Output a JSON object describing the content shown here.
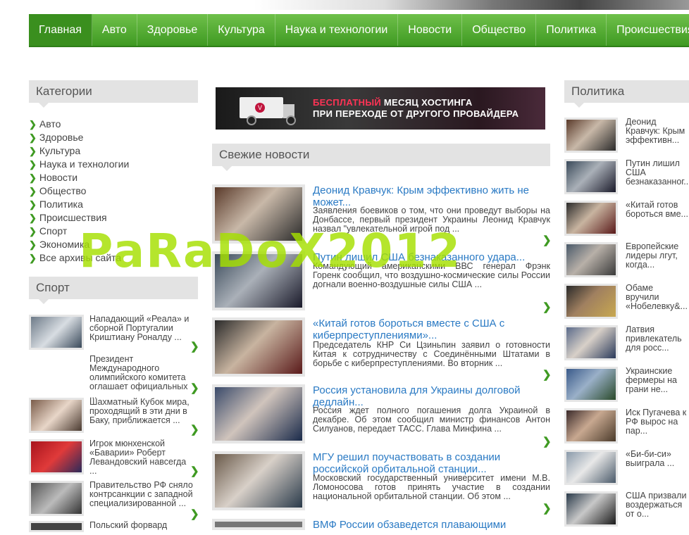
{
  "nav": [
    "Главная",
    "Авто",
    "Здоровье",
    "Культура",
    "Наука и технологии",
    "Новости",
    "Общество",
    "Политика",
    "Происшествия"
  ],
  "categories": {
    "title": "Категории",
    "items": [
      "Авто",
      "Здоровье",
      "Культура",
      "Наука и технологии",
      "Новости",
      "Общество",
      "Политика",
      "Происшествия",
      "Спорт",
      "Экономика",
      "Все архивы сайта"
    ]
  },
  "banner": {
    "line1_red": "БЕСПЛАТНЫЙ",
    "line1": " МЕСЯЦ ХОСТИНГА",
    "line2": "ПРИ ПЕРЕХОДЕ ОТ ДРУГОГО ПРОВАЙДЕРА"
  },
  "fresh": {
    "title": "Свежие новости",
    "items": [
      {
        "title": "Деонид Кравчук: Крым эффективно жить не может...",
        "text": "Заявления боевиков о том, что они проведут выборы на Донбассе, первый президент Украины Леонид Кравчук назвал \"увлекательной игрой под ..."
      },
      {
        "title": "Путин лишил США безнаказанного удара...",
        "text": "Командующий американскими ВВС генерал Фрэнк Горенк сообщил, что воздушно-космические силы России догнали военно-воздушные силы США ..."
      },
      {
        "title": "«Китай готов бороться вместе с США с киберпреступлениями»...",
        "text": "Председатель КНР Си Цзиньпин заявил о готовности Китая к сотрудничеству с Соединёнными Штатами в борьбе с киберпреступлениями. Во вторник ..."
      },
      {
        "title": "Россия установила для Украины долговой дедлайн...",
        "text": "Россия ждет полного погашения долга Украиной в декабре. Об этом сообщил министр финансов Антон Силуанов, передает ТАСС. Глава Минфина ..."
      },
      {
        "title": "МГУ решил поучаствовать в создании российской орбитальной станции...",
        "text": "Московский государственный университет имени М.В. Ломоносова готов принять участие в создании национальной орбитальной станции. Об этом ..."
      },
      {
        "title": "ВМФ России обзаведется плавающими",
        "text": ""
      }
    ]
  },
  "sport": {
    "title": "Спорт",
    "items": [
      "Нападающий «Реала» и сборной Португалии Криштиану Роналду ...",
      "Президент Международного олимпийского комитета оглашает официальных ...",
      "Шахматный Кубок мира, проходящий в эти дни в Баку, приближается ...",
      " Игрок мюнхенской «Баварии» Роберт Левандовский навсегда ...",
      "Правительство РФ сняло контрсанкции с западной специализированной ...",
      "Польский форвард"
    ]
  },
  "politics": {
    "title": "Политика",
    "items": [
      "Деонид Кравчук: Крым эффективн...",
      "Путин лишил США безнаказанног...",
      "«Китай готов бороться вме...",
      "Европейские лидеры лгут, когда...",
      "Обаме вручили «Нобелевку&...",
      "Латвия привлекатель для росс...",
      "Украинские фермеры на грани не...",
      "Иск Пугачева к РФ вырос на пар...",
      "«Би-би-си» выиграла ...",
      "США призвали воздержаться от о..."
    ]
  },
  "watermark": "PaRaDoX2012"
}
